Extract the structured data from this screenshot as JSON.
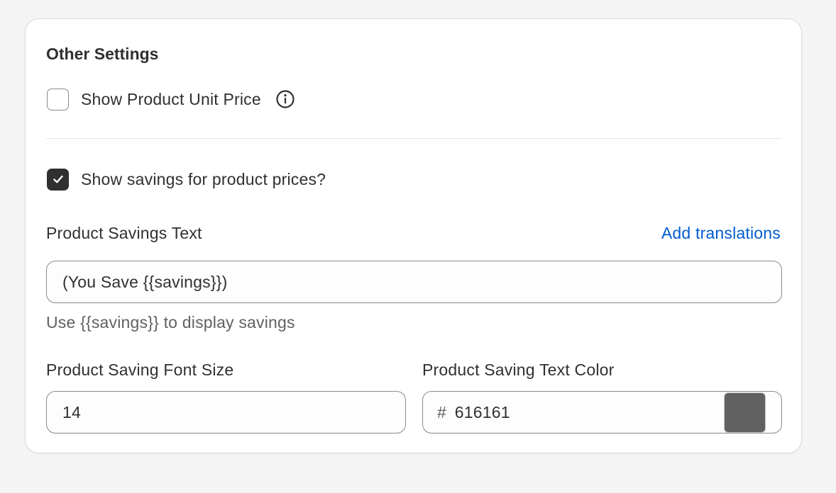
{
  "section": {
    "title": "Other Settings"
  },
  "unit_price": {
    "label": "Show Product Unit Price",
    "checked": false
  },
  "savings_toggle": {
    "label": "Show savings for product prices?",
    "checked": true
  },
  "savings_text": {
    "label": "Product Savings Text",
    "link": "Add translations",
    "value": "(You Save {{savings}})",
    "help": "Use {{savings}} to display savings"
  },
  "font_size": {
    "label": "Product Saving Font Size",
    "value": "14"
  },
  "text_color": {
    "label": "Product Saving Text Color",
    "prefix": "#",
    "value": "616161",
    "swatch_color": "#616161"
  },
  "colors": {
    "accent_link": "#005bd3",
    "checkbox_checked": "#303030"
  }
}
